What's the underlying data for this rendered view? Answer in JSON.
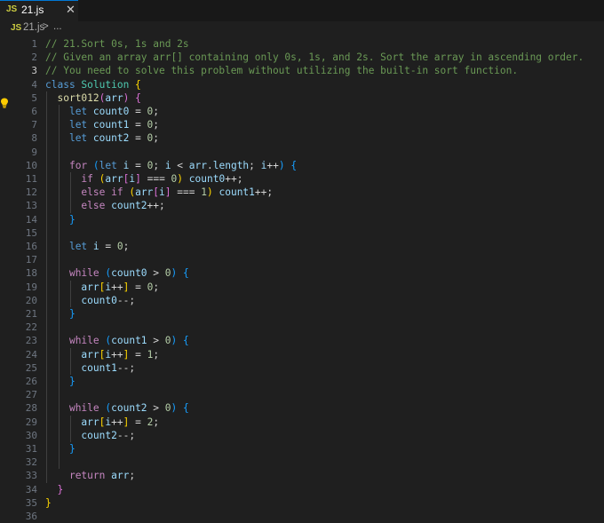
{
  "tab": {
    "icon_label": "JS",
    "filename": "21.js",
    "close_glyph": "✕"
  },
  "breadcrumb": {
    "icon_label": "JS",
    "filename": "21.js",
    "separator": ">",
    "more": "..."
  },
  "editor": {
    "active_line": 3,
    "lightbulb_line": 3,
    "line_numbers": [
      "1",
      "2",
      "3",
      "4",
      "5",
      "6",
      "7",
      "8",
      "9",
      "10",
      "11",
      "12",
      "13",
      "14",
      "15",
      "16",
      "17",
      "18",
      "19",
      "20",
      "21",
      "22",
      "23",
      "24",
      "25",
      "26",
      "27",
      "28",
      "29",
      "30",
      "31",
      "32",
      "33",
      "34",
      "35",
      "36"
    ],
    "lines": [
      [
        [
          "// 21.Sort 0s, 1s and 2s",
          "c-comment"
        ]
      ],
      [
        [
          "// Given an array arr[] containing only 0s, 1s, and 2s. Sort the array in ascending order.",
          "c-comment"
        ]
      ],
      [
        [
          "// You need to solve this problem without utilizing the built-in sort function.",
          "c-comment"
        ]
      ],
      [
        [
          "class ",
          "c-kw"
        ],
        [
          "Solution ",
          "c-cls"
        ],
        [
          "{",
          "c-b1"
        ]
      ],
      [
        [
          "  ",
          " "
        ],
        [
          "sort012",
          "c-fn"
        ],
        [
          "(",
          "c-b2"
        ],
        [
          "arr",
          "c-var"
        ],
        [
          ")",
          "c-b2"
        ],
        [
          " ",
          " "
        ],
        [
          "{",
          "c-b2"
        ]
      ],
      [
        [
          "    ",
          " "
        ],
        [
          "let ",
          "c-kw"
        ],
        [
          "count0",
          "c-var"
        ],
        [
          " = ",
          "c-op"
        ],
        [
          "0",
          "c-num"
        ],
        [
          ";",
          "c-op"
        ]
      ],
      [
        [
          "    ",
          " "
        ],
        [
          "let ",
          "c-kw"
        ],
        [
          "count1",
          "c-var"
        ],
        [
          " = ",
          "c-op"
        ],
        [
          "0",
          "c-num"
        ],
        [
          ";",
          "c-op"
        ]
      ],
      [
        [
          "    ",
          " "
        ],
        [
          "let ",
          "c-kw"
        ],
        [
          "count2",
          "c-var"
        ],
        [
          " = ",
          "c-op"
        ],
        [
          "0",
          "c-num"
        ],
        [
          ";",
          "c-op"
        ]
      ],
      [],
      [
        [
          "    ",
          " "
        ],
        [
          "for ",
          "c-ctrl"
        ],
        [
          "(",
          "c-b3"
        ],
        [
          "let ",
          "c-kw"
        ],
        [
          "i",
          "c-var"
        ],
        [
          " = ",
          "c-op"
        ],
        [
          "0",
          "c-num"
        ],
        [
          "; ",
          "c-op"
        ],
        [
          "i",
          "c-var"
        ],
        [
          " < ",
          "c-op"
        ],
        [
          "arr",
          "c-var"
        ],
        [
          ".",
          "c-op"
        ],
        [
          "length",
          "c-var"
        ],
        [
          "; ",
          "c-op"
        ],
        [
          "i",
          "c-var"
        ],
        [
          "++",
          "c-op"
        ],
        [
          ")",
          "c-b3"
        ],
        [
          " ",
          " "
        ],
        [
          "{",
          "c-b3"
        ]
      ],
      [
        [
          "      ",
          " "
        ],
        [
          "if ",
          "c-ctrl"
        ],
        [
          "(",
          "c-b1"
        ],
        [
          "arr",
          "c-var"
        ],
        [
          "[",
          "c-b2"
        ],
        [
          "i",
          "c-var"
        ],
        [
          "]",
          "c-b2"
        ],
        [
          " === ",
          "c-op"
        ],
        [
          "0",
          "c-num"
        ],
        [
          ")",
          "c-b1"
        ],
        [
          " ",
          "c-op"
        ],
        [
          "count0",
          "c-var"
        ],
        [
          "++;",
          "c-op"
        ]
      ],
      [
        [
          "      ",
          " "
        ],
        [
          "else ",
          "c-ctrl"
        ],
        [
          "if ",
          "c-ctrl"
        ],
        [
          "(",
          "c-b1"
        ],
        [
          "arr",
          "c-var"
        ],
        [
          "[",
          "c-b2"
        ],
        [
          "i",
          "c-var"
        ],
        [
          "]",
          "c-b2"
        ],
        [
          " === ",
          "c-op"
        ],
        [
          "1",
          "c-num"
        ],
        [
          ")",
          "c-b1"
        ],
        [
          " ",
          "c-op"
        ],
        [
          "count1",
          "c-var"
        ],
        [
          "++;",
          "c-op"
        ]
      ],
      [
        [
          "      ",
          " "
        ],
        [
          "else ",
          "c-ctrl"
        ],
        [
          "count2",
          "c-var"
        ],
        [
          "++;",
          "c-op"
        ]
      ],
      [
        [
          "    ",
          " "
        ],
        [
          "}",
          "c-b3"
        ]
      ],
      [],
      [
        [
          "    ",
          " "
        ],
        [
          "let ",
          "c-kw"
        ],
        [
          "i",
          "c-var"
        ],
        [
          " = ",
          "c-op"
        ],
        [
          "0",
          "c-num"
        ],
        [
          ";",
          "c-op"
        ]
      ],
      [],
      [
        [
          "    ",
          " "
        ],
        [
          "while ",
          "c-ctrl"
        ],
        [
          "(",
          "c-b3"
        ],
        [
          "count0",
          "c-var"
        ],
        [
          " > ",
          "c-op"
        ],
        [
          "0",
          "c-num"
        ],
        [
          ")",
          "c-b3"
        ],
        [
          " ",
          " "
        ],
        [
          "{",
          "c-b3"
        ]
      ],
      [
        [
          "      ",
          " "
        ],
        [
          "arr",
          "c-var"
        ],
        [
          "[",
          "c-b1"
        ],
        [
          "i",
          "c-var"
        ],
        [
          "++",
          "c-op"
        ],
        [
          "]",
          "c-b1"
        ],
        [
          " = ",
          "c-op"
        ],
        [
          "0",
          "c-num"
        ],
        [
          ";",
          "c-op"
        ]
      ],
      [
        [
          "      ",
          " "
        ],
        [
          "count0",
          "c-var"
        ],
        [
          "--;",
          "c-op"
        ]
      ],
      [
        [
          "    ",
          " "
        ],
        [
          "}",
          "c-b3"
        ]
      ],
      [],
      [
        [
          "    ",
          " "
        ],
        [
          "while ",
          "c-ctrl"
        ],
        [
          "(",
          "c-b3"
        ],
        [
          "count1",
          "c-var"
        ],
        [
          " > ",
          "c-op"
        ],
        [
          "0",
          "c-num"
        ],
        [
          ")",
          "c-b3"
        ],
        [
          " ",
          " "
        ],
        [
          "{",
          "c-b3"
        ]
      ],
      [
        [
          "      ",
          " "
        ],
        [
          "arr",
          "c-var"
        ],
        [
          "[",
          "c-b1"
        ],
        [
          "i",
          "c-var"
        ],
        [
          "++",
          "c-op"
        ],
        [
          "]",
          "c-b1"
        ],
        [
          " = ",
          "c-op"
        ],
        [
          "1",
          "c-num"
        ],
        [
          ";",
          "c-op"
        ]
      ],
      [
        [
          "      ",
          " "
        ],
        [
          "count1",
          "c-var"
        ],
        [
          "--;",
          "c-op"
        ]
      ],
      [
        [
          "    ",
          " "
        ],
        [
          "}",
          "c-b3"
        ]
      ],
      [],
      [
        [
          "    ",
          " "
        ],
        [
          "while ",
          "c-ctrl"
        ],
        [
          "(",
          "c-b3"
        ],
        [
          "count2",
          "c-var"
        ],
        [
          " > ",
          "c-op"
        ],
        [
          "0",
          "c-num"
        ],
        [
          ")",
          "c-b3"
        ],
        [
          " ",
          " "
        ],
        [
          "{",
          "c-b3"
        ]
      ],
      [
        [
          "      ",
          " "
        ],
        [
          "arr",
          "c-var"
        ],
        [
          "[",
          "c-b1"
        ],
        [
          "i",
          "c-var"
        ],
        [
          "++",
          "c-op"
        ],
        [
          "]",
          "c-b1"
        ],
        [
          " = ",
          "c-op"
        ],
        [
          "2",
          "c-num"
        ],
        [
          ";",
          "c-op"
        ]
      ],
      [
        [
          "      ",
          " "
        ],
        [
          "count2",
          "c-var"
        ],
        [
          "--;",
          "c-op"
        ]
      ],
      [
        [
          "    ",
          " "
        ],
        [
          "}",
          "c-b3"
        ]
      ],
      [],
      [
        [
          "    ",
          " "
        ],
        [
          "return ",
          "c-ctrl"
        ],
        [
          "arr",
          "c-var"
        ],
        [
          ";",
          "c-op"
        ]
      ],
      [
        [
          "  ",
          " "
        ],
        [
          "}",
          "c-b2"
        ]
      ],
      [
        [
          "}",
          "c-b1"
        ]
      ],
      []
    ]
  },
  "colors": {
    "background": "#1f1f1f",
    "tabbar": "#181818",
    "accent": "#0078d4",
    "js_icon": "#cbcb41",
    "bulb": "#ffcc00"
  }
}
